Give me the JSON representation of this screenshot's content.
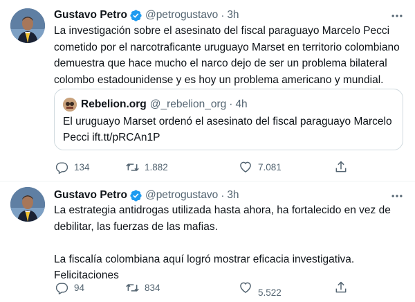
{
  "tweets": [
    {
      "author": {
        "name": "Gustavo Petro",
        "handle": "@petrogustavo",
        "verified": true
      },
      "time": "3h",
      "separator": "·",
      "text": "La investigación sobre el asesinato del fiscal paraguayo Marcelo Pecci\ncometido por el narcotraficante uruguayo Marset en territorio colombiano\ndemuestra que hace mucho el narco dejo de ser un problema bilateral\ncolombo estadounidense y es hoy un problema americano y mundial.",
      "quote": {
        "author": {
          "name": "Rebelion.org",
          "handle": "@_rebelion_org"
        },
        "time": "4h",
        "separator": "·",
        "text": "El uruguayo Marset ordenó el asesinato del fiscal paraguayo Marcelo\nPecci ift.tt/pRCAn1P"
      },
      "actions": {
        "replies": "134",
        "retweets": "1.882",
        "likes": "7.081"
      }
    },
    {
      "author": {
        "name": "Gustavo Petro",
        "handle": "@petrogustavo",
        "verified": true
      },
      "time": "3h",
      "separator": "·",
      "text": "La estrategia antidrogas utilizada hasta ahora, ha fortalecido en vez de\ndebilitar, las fuerzas de las mafias.\n\nLa fiscalía colombiana aquí logró mostrar eficacia investigativa.\nFelicitaciones",
      "actions": {
        "replies": "94",
        "retweets": "834",
        "likes": "5.522"
      }
    }
  ],
  "icons": {
    "verified": "verified-badge-icon",
    "more": "more-horizontal-icon",
    "reply": "reply-icon",
    "retweet": "retweet-icon",
    "like": "heart-icon",
    "share": "share-icon"
  },
  "colors": {
    "text": "#0f1419",
    "secondary": "#536471",
    "verified": "#1d9bf0",
    "border": "#cfd9de"
  }
}
